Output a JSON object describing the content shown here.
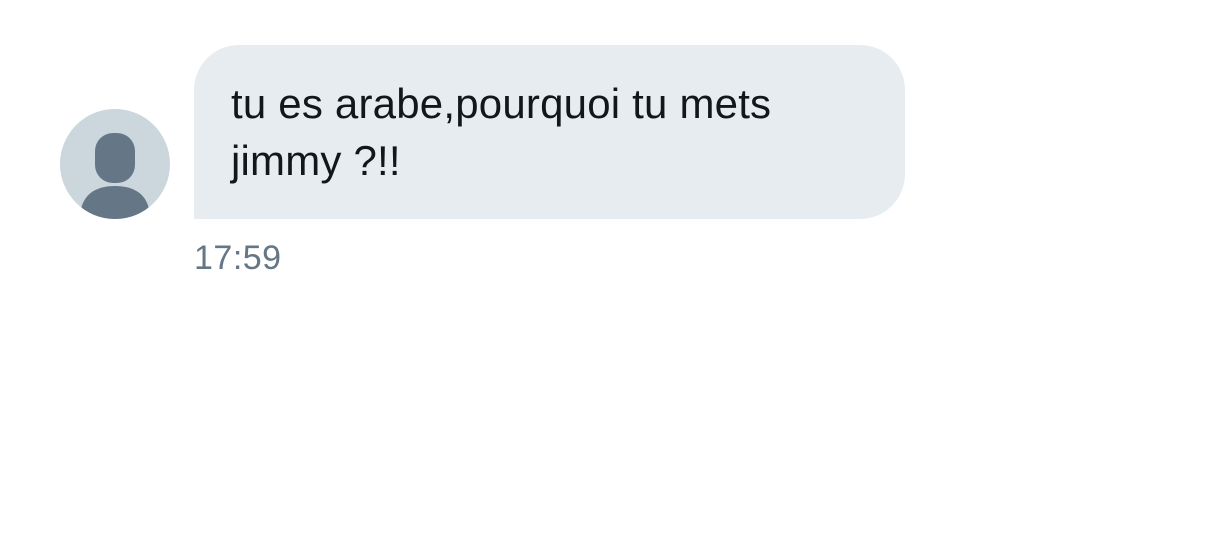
{
  "conversation": {
    "messages": [
      {
        "sender_avatar_icon": "default-user-icon",
        "text": "tu es arabe,pourquoi tu mets\njimmy ?!!",
        "time": "17:59"
      }
    ]
  },
  "colors": {
    "bubble_bg": "#e6ecf0",
    "avatar_bg": "#ccd6dd",
    "avatar_figure": "#657786",
    "message_text": "#14171a",
    "timestamp_text": "#657786"
  }
}
